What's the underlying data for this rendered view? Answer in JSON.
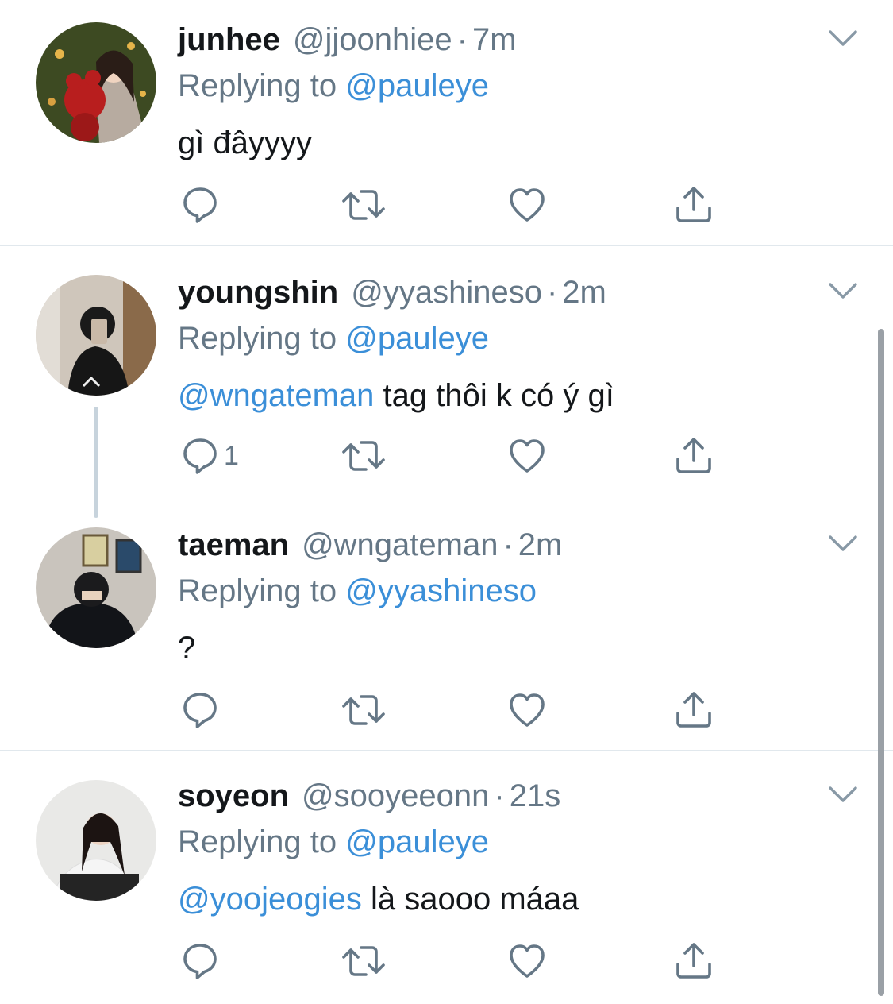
{
  "tweets": [
    {
      "name": "junhee",
      "handle": "@jjoonhiee",
      "separator": "·",
      "time": "7m",
      "replying_prefix": "Replying to",
      "replying_to": "@pauleye",
      "body_mention": "",
      "body_text": "gì đâyyyy",
      "reply_count": ""
    },
    {
      "name": "youngshin",
      "handle": "@yyashineso",
      "separator": "·",
      "time": "2m",
      "replying_prefix": "Replying to",
      "replying_to": "@pauleye",
      "body_mention": "@wngateman",
      "body_text": "tag thôi k có ý gì",
      "reply_count": "1"
    },
    {
      "name": "taeman",
      "handle": "@wngateman",
      "separator": "·",
      "time": "2m",
      "replying_prefix": "Replying to",
      "replying_to": "@yyashineso",
      "body_mention": "",
      "body_text": "?",
      "reply_count": ""
    },
    {
      "name": "soyeon",
      "handle": "@sooyeeonn",
      "separator": "·",
      "time": "21s",
      "replying_prefix": "Replying to",
      "replying_to": "@pauleye",
      "body_mention": "@yoojeogies",
      "body_text": "là saooo máaa",
      "reply_count": ""
    }
  ],
  "colors": {
    "mention": "#3b8fd8",
    "secondary_text": "#657786",
    "icon": "#657786",
    "divider": "#e1e8ed"
  },
  "icons": [
    "reply-icon",
    "retweet-icon",
    "like-icon",
    "share-icon",
    "chevron-down-icon"
  ]
}
